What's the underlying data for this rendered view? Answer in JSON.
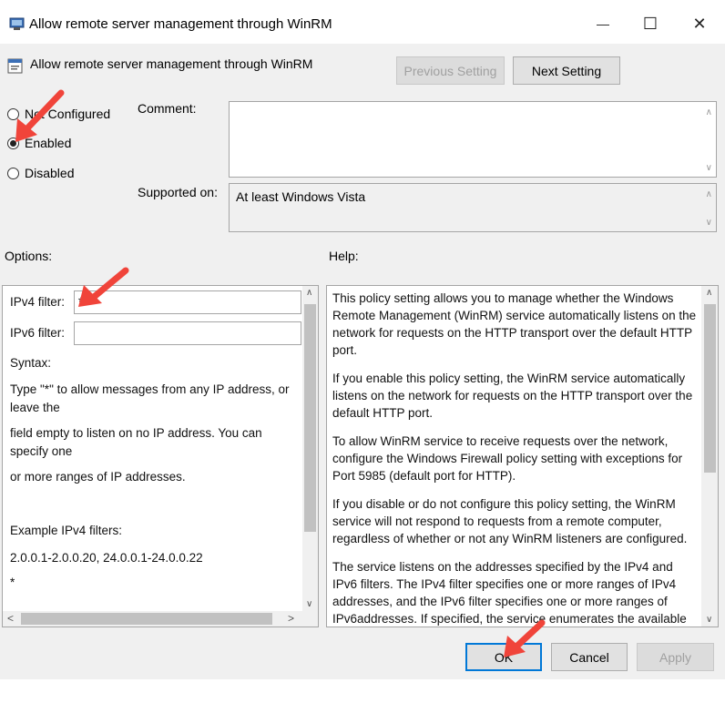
{
  "window": {
    "title": "Allow remote server management through WinRM",
    "controls": {
      "minimize": "—",
      "maximize": "☐",
      "close": "✕"
    }
  },
  "policy": {
    "name": "Allow remote server management through WinRM",
    "previous_label": "Previous Setting",
    "next_label": "Next Setting"
  },
  "state": {
    "not_configured_label": "Not Configured",
    "enabled_label": "Enabled",
    "disabled_label": "Disabled",
    "selected": "enabled"
  },
  "comment": {
    "label": "Comment:",
    "value": ""
  },
  "supported": {
    "label": "Supported on:",
    "value": "At least Windows Vista"
  },
  "options": {
    "label": "Options:",
    "ipv4_label": "IPv4 filter:",
    "ipv4_value": "*",
    "ipv6_label": "IPv6 filter:",
    "ipv6_value": "",
    "syntax": "Syntax:",
    "line1": "Type \"*\" to allow messages from any IP address, or leave the",
    "line2": "field empty to listen on no IP address. You can specify one",
    "line3": "or more ranges of IP addresses.",
    "example_label": "Example IPv4 filters:",
    "example_value": "2.0.0.1-2.0.0.20, 24.0.0.1-24.0.0.22",
    "asterisk": "*"
  },
  "help": {
    "label": "Help:",
    "paragraphs": [
      "This policy setting allows you to manage whether the Windows Remote Management (WinRM) service automatically listens on the network for requests on the HTTP transport over the default HTTP port.",
      "If you enable this policy setting, the WinRM service automatically listens on the network for requests on the HTTP transport over the default HTTP port.",
      "To allow WinRM service to receive requests over the network, configure the Windows Firewall policy setting with exceptions for Port 5985 (default port for HTTP).",
      "If you disable or do not configure this policy setting, the WinRM service will not respond to requests from a remote computer, regardless of whether or not any WinRM listeners are configured.",
      "The service listens on the addresses specified by the IPv4 and IPv6 filters. The IPv4 filter specifies one or more ranges of IPv4 addresses, and the IPv6 filter specifies one or more ranges of IPv6addresses. If specified, the service enumerates the available"
    ]
  },
  "buttons": {
    "ok": "OK",
    "cancel": "Cancel",
    "apply": "Apply"
  },
  "colors": {
    "annotation_arrow": "#f0443a",
    "focus_border": "#0078d7"
  }
}
